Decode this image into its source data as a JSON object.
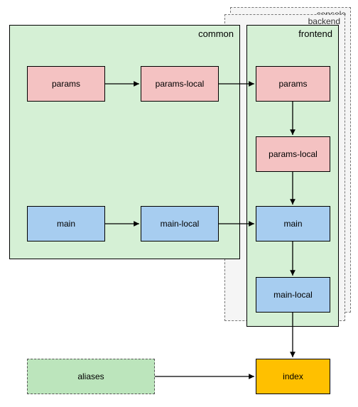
{
  "stack": {
    "console": "console",
    "backend": "backend",
    "frontend": "frontend"
  },
  "common": {
    "label": "common",
    "params": "params",
    "params_local": "params-local",
    "main": "main",
    "main_local": "main-local"
  },
  "frontend_nodes": {
    "params": "params",
    "params_local": "params-local",
    "main": "main",
    "main_local": "main-local"
  },
  "bottom": {
    "aliases": "aliases",
    "index": "index"
  },
  "colors": {
    "pink": "#f4c2c2",
    "blue": "#a7cdf0",
    "green_container": "#d5f0d5",
    "green_aliases": "#bce5bc",
    "orange": "#ffc000"
  }
}
